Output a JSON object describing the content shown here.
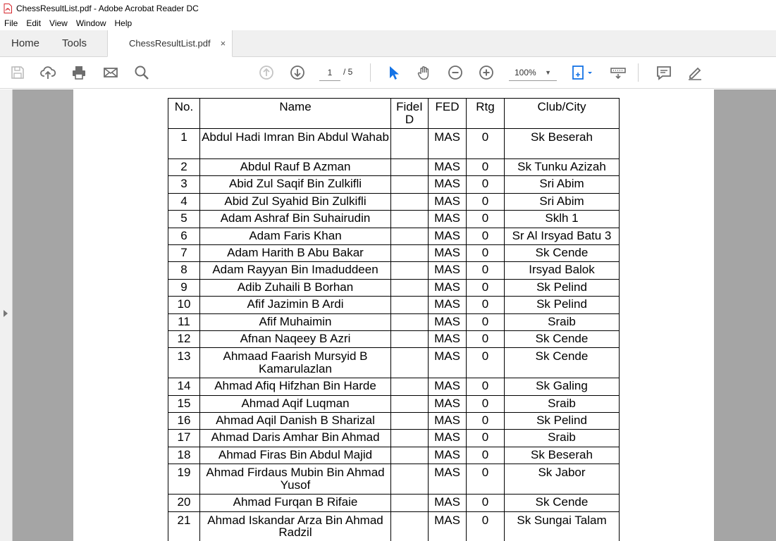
{
  "window": {
    "title": "ChessResultList.pdf - Adobe Acrobat Reader DC"
  },
  "menu": [
    "File",
    "Edit",
    "View",
    "Window",
    "Help"
  ],
  "tabs": {
    "home": "Home",
    "tools": "Tools",
    "document": "ChessResultList.pdf",
    "close": "×"
  },
  "toolbar": {
    "page_current": "1",
    "page_total": "/ 5",
    "zoom": "100%",
    "zoom_arrow": "▼"
  },
  "colors": {
    "accent": "#1473e6",
    "icon": "#6d6d6d",
    "workspace": "#a5a5a5"
  },
  "icons": [
    "save-icon",
    "upload-icon",
    "print-icon",
    "mail-icon",
    "search-icon",
    "page-up-icon",
    "page-down-icon",
    "select-arrow-icon",
    "hand-icon",
    "zoom-out-icon",
    "zoom-in-icon",
    "fit-page-icon",
    "keyboard-icon",
    "comment-icon",
    "sign-icon"
  ],
  "table": {
    "headers": {
      "no": "No.",
      "name": "Name",
      "fide": "FideI D",
      "fed": "FED",
      "rtg": "Rtg",
      "club": "Club/City"
    },
    "rows": [
      {
        "no": "1",
        "name": "Abdul Hadi Imran Bin Abdul Wahab",
        "fed": "MAS",
        "rtg": "0",
        "club": "Sk Beserah",
        "tall": true
      },
      {
        "no": "2",
        "name": "Abdul Rauf B Azman",
        "fed": "MAS",
        "rtg": "0",
        "club": "Sk Tunku Azizah"
      },
      {
        "no": "3",
        "name": "Abid Zul Saqif Bin Zulkifli",
        "fed": "MAS",
        "rtg": "0",
        "club": "Sri Abim"
      },
      {
        "no": "4",
        "name": "Abid Zul Syahid Bin Zulkifli",
        "fed": "MAS",
        "rtg": "0",
        "club": "Sri Abim"
      },
      {
        "no": "5",
        "name": "Adam Ashraf Bin Suhairudin",
        "fed": "MAS",
        "rtg": "0",
        "club": "Sklh 1"
      },
      {
        "no": "6",
        "name": "Adam Faris Khan",
        "fed": "MAS",
        "rtg": "0",
        "club": "Sr Al Irsyad Batu 3"
      },
      {
        "no": "7",
        "name": "Adam Harith B Abu Bakar",
        "fed": "MAS",
        "rtg": "0",
        "club": "Sk Cende"
      },
      {
        "no": "8",
        "name": "Adam Rayyan Bin Imaduddeen",
        "fed": "MAS",
        "rtg": "0",
        "club": "Irsyad Balok"
      },
      {
        "no": "9",
        "name": "Adib Zuhaili B Borhan",
        "fed": "MAS",
        "rtg": "0",
        "club": "Sk Pelind"
      },
      {
        "no": "10",
        "name": "Afif Jazimin B Ardi",
        "fed": "MAS",
        "rtg": "0",
        "club": "Sk Pelind"
      },
      {
        "no": "11",
        "name": "Afif Muhaimin",
        "fed": "MAS",
        "rtg": "0",
        "club": "Sraib"
      },
      {
        "no": "12",
        "name": "Afnan Naqeey B Azri",
        "fed": "MAS",
        "rtg": "0",
        "club": "Sk Cende"
      },
      {
        "no": "13",
        "name": "Ahmaad Faarish Mursyid B Kamarulazlan",
        "fed": "MAS",
        "rtg": "0",
        "club": "Sk Cende",
        "tall": true
      },
      {
        "no": "14",
        "name": "Ahmad Afiq Hifzhan Bin Harde",
        "fed": "MAS",
        "rtg": "0",
        "club": "Sk Galing"
      },
      {
        "no": "15",
        "name": "Ahmad Aqif Luqman",
        "fed": "MAS",
        "rtg": "0",
        "club": "Sraib"
      },
      {
        "no": "16",
        "name": "Ahmad Aqil Danish B Sharizal",
        "fed": "MAS",
        "rtg": "0",
        "club": "Sk Pelind"
      },
      {
        "no": "17",
        "name": "Ahmad Daris Amhar Bin Ahmad",
        "fed": "MAS",
        "rtg": "0",
        "club": "Sraib"
      },
      {
        "no": "18",
        "name": "Ahmad Firas Bin Abdul Majid",
        "fed": "MAS",
        "rtg": "0",
        "club": "Sk Beserah"
      },
      {
        "no": "19",
        "name": "Ahmad Firdaus Mubin Bin Ahmad Yusof",
        "fed": "MAS",
        "rtg": "0",
        "club": "Sk Jabor",
        "tall": true
      },
      {
        "no": "20",
        "name": "Ahmad Furqan B Rifaie",
        "fed": "MAS",
        "rtg": "0",
        "club": "Sk Cende"
      },
      {
        "no": "21",
        "name": "Ahmad Iskandar Arza Bin Ahmad Radzil",
        "fed": "MAS",
        "rtg": "0",
        "club": "Sk Sungai Talam",
        "tall": true
      }
    ]
  }
}
